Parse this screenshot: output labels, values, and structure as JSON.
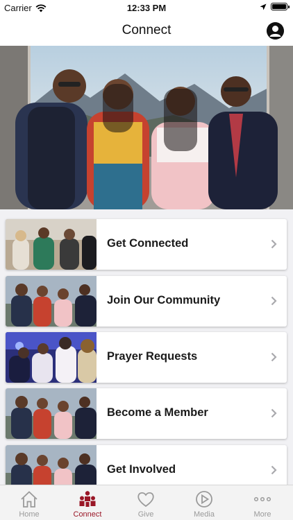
{
  "status_bar": {
    "carrier": "Carrier",
    "time": "12:33 PM"
  },
  "nav": {
    "title": "Connect"
  },
  "cards": [
    {
      "label": "Get Connected"
    },
    {
      "label": "Join Our Community"
    },
    {
      "label": "Prayer Requests"
    },
    {
      "label": "Become a Member"
    },
    {
      "label": "Get Involved"
    }
  ],
  "tabs": [
    {
      "label": "Home",
      "icon": "home-icon"
    },
    {
      "label": "Connect",
      "icon": "people-icon",
      "active": true
    },
    {
      "label": "Give",
      "icon": "heart-icon"
    },
    {
      "label": "Media",
      "icon": "play-icon"
    },
    {
      "label": "More",
      "icon": "more-dots-icon"
    }
  ],
  "colors": {
    "accent": "#9a1727",
    "inactive": "#9a9a9a",
    "tab_bar_bg": "#f3f3f3"
  }
}
